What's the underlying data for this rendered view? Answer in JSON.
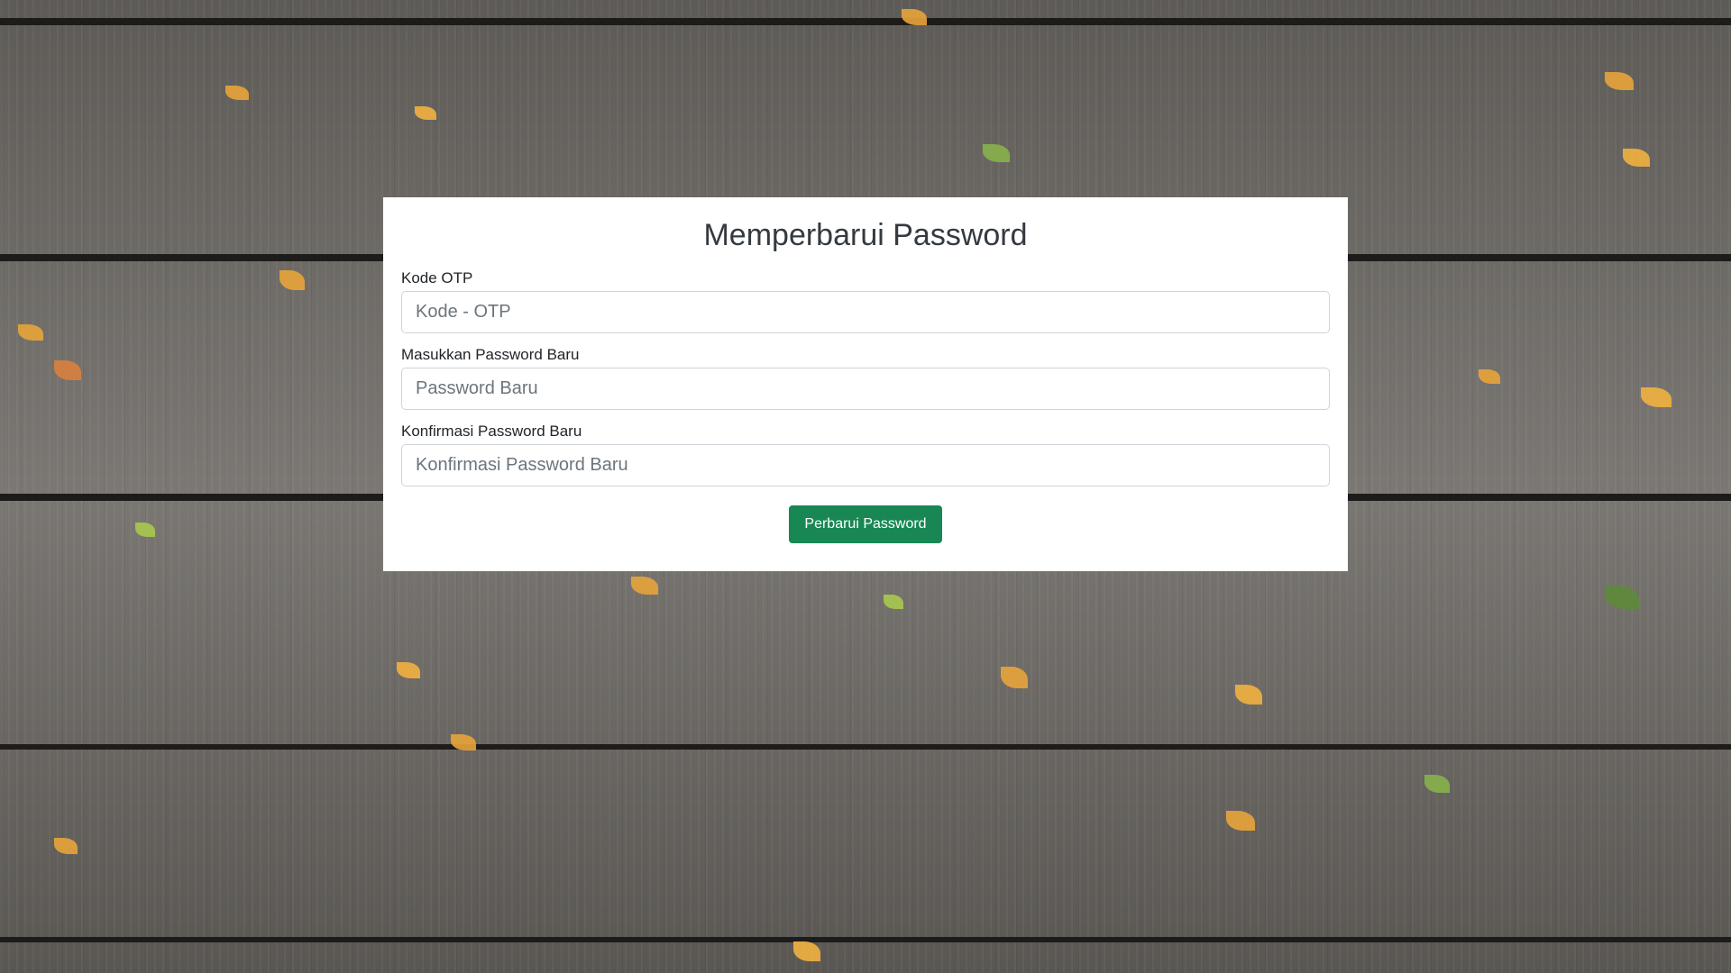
{
  "page": {
    "title": "Memperbarui Password"
  },
  "form": {
    "otp": {
      "label": "Kode OTP",
      "placeholder": "Kode - OTP",
      "value": ""
    },
    "new_password": {
      "label": "Masukkan Password Baru",
      "placeholder": "Password Baru",
      "value": ""
    },
    "confirm_password": {
      "label": "Konfirmasi Password Baru",
      "placeholder": "Konfirmasi Password Baru",
      "value": ""
    },
    "submit_label": "Perbarui Password"
  },
  "colors": {
    "accent": "#198754",
    "card_background": "#ffffff",
    "title_text": "#343a40"
  }
}
